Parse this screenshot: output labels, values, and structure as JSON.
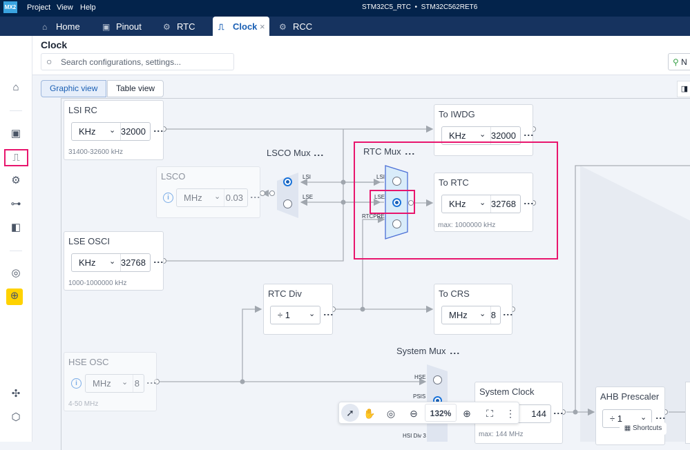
{
  "app": {
    "logo": "MX2",
    "menu": [
      "Project",
      "View",
      "Help"
    ],
    "project": "STM32C5_RTC",
    "separator": "•",
    "device": "STM32C562RET6"
  },
  "tabs": [
    {
      "label": "Home",
      "icon": "home-icon"
    },
    {
      "label": "Pinout",
      "icon": "chip-icon"
    },
    {
      "label": "RTC",
      "icon": "peripheral-icon"
    },
    {
      "label": "Clock",
      "icon": "clock-wave-icon",
      "active": true,
      "close": "×"
    },
    {
      "label": "RCC",
      "icon": "peripheral-icon"
    }
  ],
  "header": {
    "title": "Clock",
    "search_placeholder": "Search configurations, settings...",
    "right_button": "N"
  },
  "views": {
    "graphic": "Graphic view",
    "table": "Table view",
    "active": "graphic"
  },
  "sidebar": [
    "home-icon",
    "chip-icon",
    "clock-wave-icon",
    "peripheral-icon",
    "connectivity-icon",
    "board-icon",
    "settings-chip-icon",
    "upload-icon",
    "puzzle-icon",
    "gear-icon"
  ],
  "blocks": {
    "lsi": {
      "title": "LSI RC",
      "unit": "KHz",
      "value": "32000",
      "range": "31400-32600 kHz"
    },
    "iwdg": {
      "title": "To IWDG",
      "unit": "KHz",
      "value": "32000"
    },
    "lsco": {
      "title": "LSCO",
      "unit": "MHz",
      "value": "0.03",
      "info": "i"
    },
    "lscomux": {
      "title": "LSCO Mux",
      "inputs": [
        "LSI",
        "LSE"
      ],
      "selected": "LSI"
    },
    "rtcmux": {
      "title": "RTC Mux",
      "inputs": [
        "LSI",
        "LSE",
        "RTCPRE"
      ],
      "selected": "LSE"
    },
    "rtc": {
      "title": "To RTC",
      "unit": "KHz",
      "value": "32768",
      "max": "max: 1000000 kHz"
    },
    "lse": {
      "title": "LSE OSCI",
      "unit": "KHz",
      "value": "32768",
      "range": "1000-1000000 kHz"
    },
    "rtcdiv": {
      "title": "RTC Div",
      "value": "÷ 1"
    },
    "crs": {
      "title": "To CRS",
      "unit": "MHz",
      "value": "8"
    },
    "hse": {
      "title": "HSE OSC",
      "unit": "MHz",
      "value": "8",
      "range": "4-50 MHz",
      "info": "i"
    },
    "sysmux": {
      "title": "System Mux",
      "inputs": [
        "HSE",
        "PSIS",
        "HSI Div 3"
      ],
      "selected": "PSIS"
    },
    "sysclk": {
      "title": "System Clock",
      "value": "144",
      "max": "max: 144 MHz"
    },
    "ahb": {
      "title": "AHB Prescaler",
      "value": "÷ 1"
    }
  },
  "toolbar": {
    "zoom": "132%"
  },
  "shortcuts": "Shortcuts",
  "colors": {
    "highlight": "#e8156d",
    "accent": "#1a5fb4",
    "nav": "#03234b"
  }
}
